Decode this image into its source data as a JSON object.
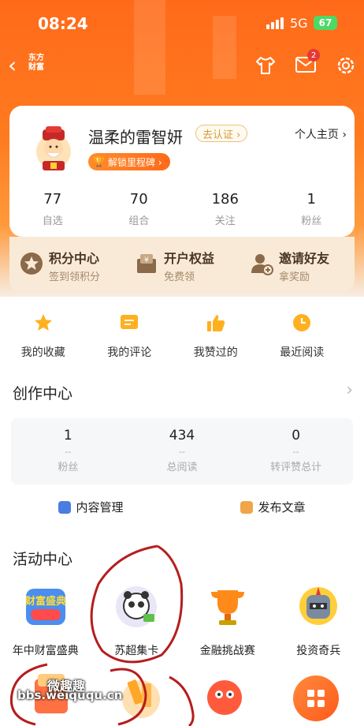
{
  "status_bar": {
    "time": "08:24",
    "network": "5G",
    "battery": "67"
  },
  "nav": {
    "brand_line1": "东方",
    "brand_line2": "财富",
    "mail_badge": "2"
  },
  "profile": {
    "username": "温柔的雷智妍",
    "verify_label": "去认证 ›",
    "homepage_label": "个人主页 ›",
    "milestone_label": "解锁里程碑 ›",
    "stats": [
      {
        "value": "77",
        "label": "自选"
      },
      {
        "value": "70",
        "label": "组合"
      },
      {
        "value": "186",
        "label": "关注"
      },
      {
        "value": "1",
        "label": "粉丝"
      }
    ]
  },
  "benefits": [
    {
      "title": "积分中心",
      "subtitle": "签到领积分"
    },
    {
      "title": "开户权益",
      "subtitle": "免费领"
    },
    {
      "title": "邀请好友",
      "subtitle": "拿奖励"
    }
  ],
  "quick_links": [
    {
      "label": "我的收藏",
      "icon": "star-icon"
    },
    {
      "label": "我的评论",
      "icon": "comment-icon"
    },
    {
      "label": "我赞过的",
      "icon": "thumbs-up-icon"
    },
    {
      "label": "最近阅读",
      "icon": "clock-icon"
    }
  ],
  "creation": {
    "title": "创作中心",
    "stats": [
      {
        "value": "1",
        "dash": "--",
        "label": "粉丝"
      },
      {
        "value": "434",
        "dash": "--",
        "label": "总阅读"
      },
      {
        "value": "0",
        "dash": "--",
        "label": "转评赞总计"
      }
    ],
    "manage_label": "内容管理",
    "publish_label": "发布文章"
  },
  "activities": {
    "title": "活动中心",
    "items": [
      {
        "label": "年中财富盛典",
        "art_text": "财富盛典"
      },
      {
        "label": "苏超集卡"
      },
      {
        "label": "金融挑战赛"
      },
      {
        "label": "投资奇兵"
      }
    ]
  },
  "watermark": {
    "title": "微趣趣",
    "url": "bbs.weiququ.cn"
  },
  "colors": {
    "brand_orange": "#ff6a1a",
    "gold": "#d39a3a",
    "badge_red": "#e53935",
    "annotation_red": "#b51d1d"
  }
}
